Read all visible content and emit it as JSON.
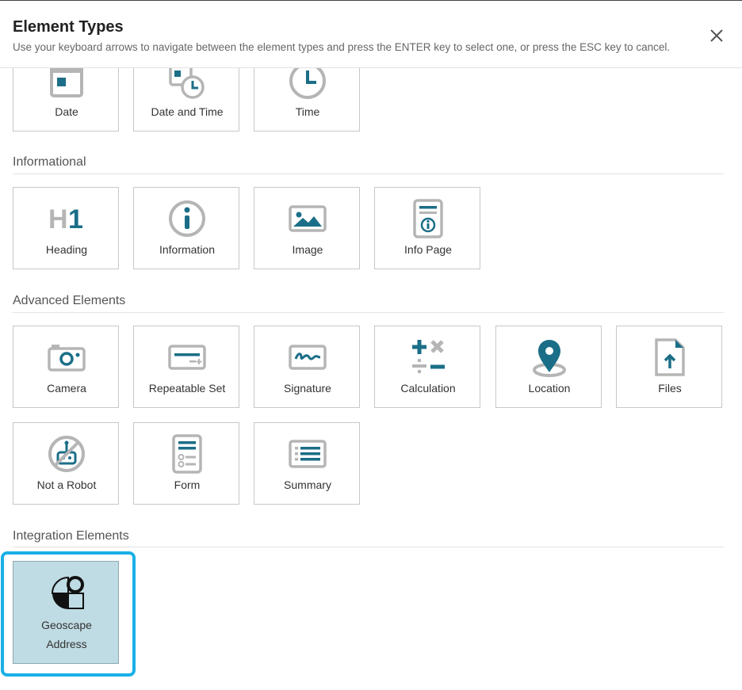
{
  "dialog": {
    "title": "Element Types",
    "subtitle": "Use your keyboard arrows to navigate between the element types and press the ENTER key to select one, or press the ESC key to cancel."
  },
  "top_row": [
    {
      "label": "Date",
      "icon": "calendar-icon"
    },
    {
      "label": "Date and Time",
      "icon": "date-time-icon"
    },
    {
      "label": "Time",
      "icon": "clock-icon"
    }
  ],
  "sections": {
    "informational": {
      "title": "Informational",
      "items": [
        {
          "label": "Heading",
          "icon": "heading-icon"
        },
        {
          "label": "Information",
          "icon": "info-icon"
        },
        {
          "label": "Image",
          "icon": "image-icon"
        },
        {
          "label": "Info Page",
          "icon": "info-page-icon"
        }
      ]
    },
    "advanced": {
      "title": "Advanced Elements",
      "items": [
        {
          "label": "Camera",
          "icon": "camera-icon"
        },
        {
          "label": "Repeatable Set",
          "icon": "repeatable-set-icon"
        },
        {
          "label": "Signature",
          "icon": "signature-icon"
        },
        {
          "label": "Calculation",
          "icon": "calculator-icon"
        },
        {
          "label": "Location",
          "icon": "location-pin-icon"
        },
        {
          "label": "Files",
          "icon": "file-upload-icon"
        },
        {
          "label": "Not a Robot",
          "icon": "robot-icon"
        },
        {
          "label": "Form",
          "icon": "form-icon"
        },
        {
          "label": "Summary",
          "icon": "summary-list-icon"
        }
      ]
    },
    "integration": {
      "title": "Integration Elements",
      "items": [
        {
          "label_line1": "Geoscape",
          "label_line2": "Address",
          "icon": "geoscape-icon",
          "selected": true
        }
      ]
    }
  },
  "colors": {
    "accent": "#1b6e87",
    "icon_gray": "#b5b5b5",
    "selected_bg": "#bfdbe3",
    "focus_ring": "#1ab0e6"
  }
}
